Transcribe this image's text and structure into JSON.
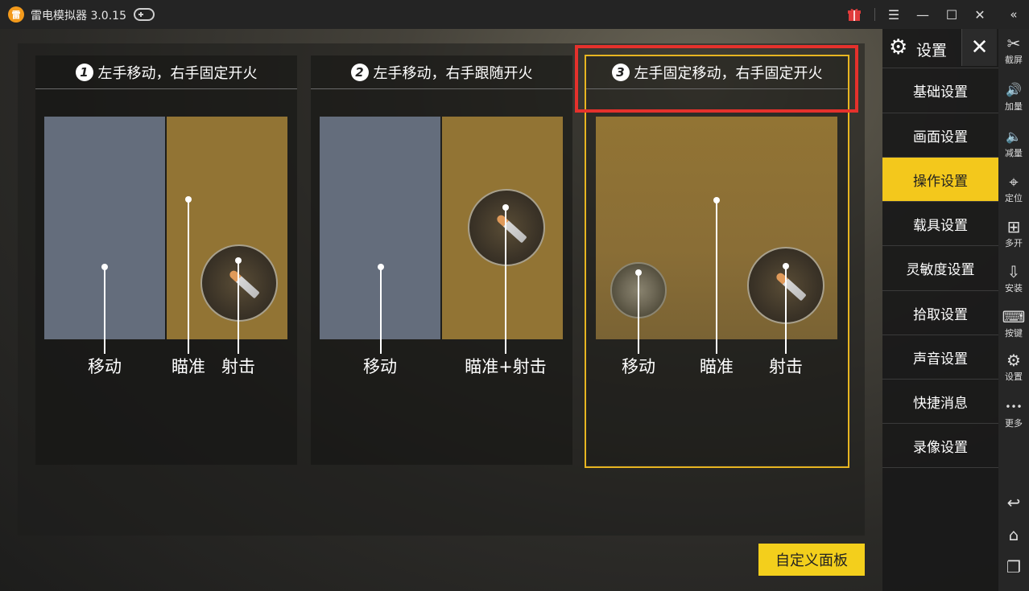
{
  "app": {
    "logo": "雷",
    "title": "雷电模拟器 3.0.15"
  },
  "titlebar": {
    "gift_icon": "gift-icon",
    "menu": "☰",
    "min": "—",
    "max": "☐",
    "close": "✕",
    "collapse": "«"
  },
  "cards": [
    {
      "num": "1",
      "title": "左手移动，右手固定开火",
      "labels": [
        "移动",
        "瞄准",
        "射击"
      ]
    },
    {
      "num": "2",
      "title": "左手移动，右手跟随开火",
      "labels": [
        "移动",
        "瞄准+射击"
      ]
    },
    {
      "num": "3",
      "title": "左手固定移动，右手固定开火",
      "labels": [
        "移动",
        "瞄准",
        "射击"
      ]
    }
  ],
  "custom_panel_button": "自定义面板",
  "settings": {
    "gear": "⚙",
    "title": "设置",
    "close": "✕",
    "items": [
      "基础设置",
      "画面设置",
      "操作设置",
      "载具设置",
      "灵敏度设置",
      "拾取设置",
      "声音设置",
      "快捷消息",
      "录像设置"
    ],
    "active_item": "操作设置"
  },
  "toolbar": [
    {
      "icon": "✂",
      "label": "截屏"
    },
    {
      "icon": "🔊",
      "label": "加量"
    },
    {
      "icon": "🔈",
      "label": "减量"
    },
    {
      "icon": "⌖",
      "label": "定位"
    },
    {
      "icon": "⊞",
      "label": "多开"
    },
    {
      "icon": "⇩",
      "label": "安装"
    },
    {
      "icon": "⌨",
      "label": "按键"
    },
    {
      "icon": "⚙",
      "label": "设置"
    },
    {
      "icon": "•••",
      "label": "更多"
    }
  ],
  "nav": {
    "back": "↩",
    "home": "⌂",
    "recent": "❐"
  },
  "colors": {
    "accent": "#f3c81c",
    "highlight": "#e5312c",
    "card3_border": "#e7b521"
  }
}
